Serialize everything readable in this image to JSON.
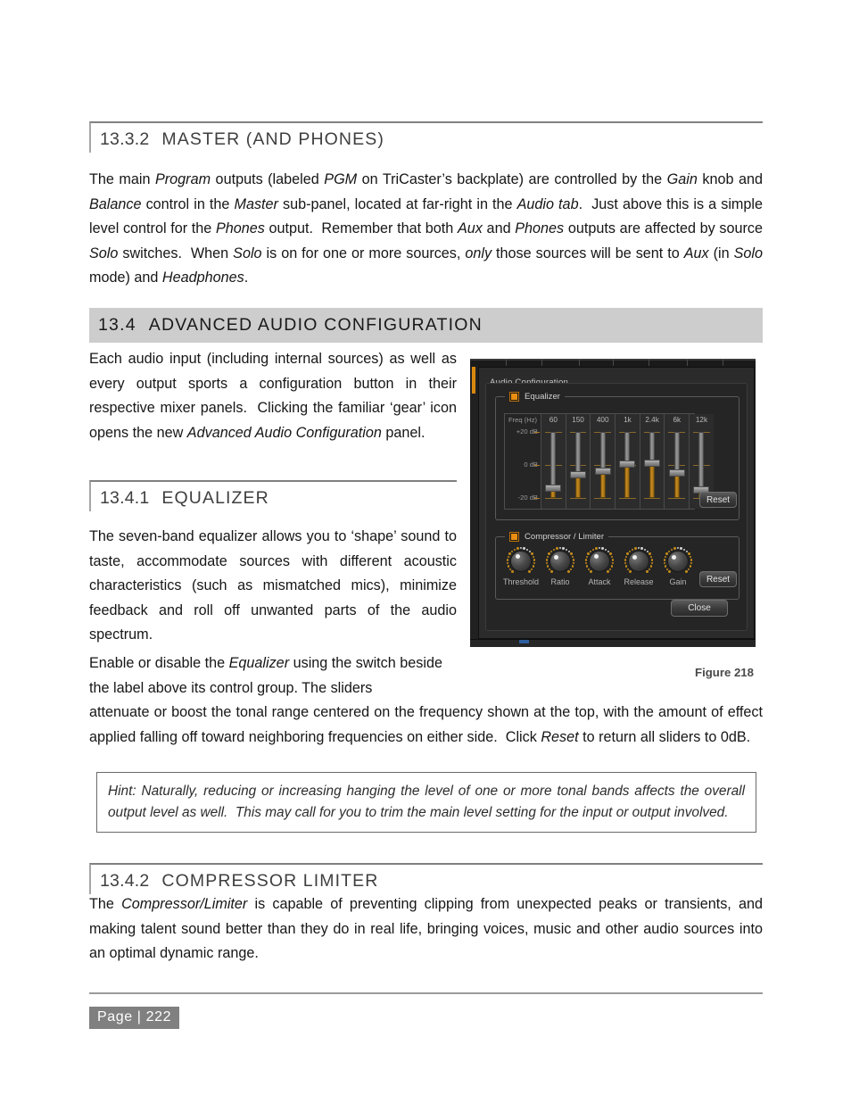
{
  "document": {
    "section_13_3_2": {
      "number": "13.3.2",
      "title": "MASTER (AND PHONES)",
      "body_html": "The main <i>Program</i> outputs (labeled <i>PGM</i> on TriCaster&rsquo;s backplate) are controlled by the <i>Gain</i> knob and <i>Balance</i> control in the <i>Master</i> sub-panel, located at far-right in the <i>Audio tab</i>.&nbsp; Just above this is a simple level control for the <i>Phones</i> output.&nbsp; Remember that both <i>Aux</i> and <i>Phones</i> outputs are affected by source <i>Solo</i> switches.&nbsp; When <i>Solo</i> is on for one or more sources, <i>only</i> those sources will be sent to <i>Aux</i> (in <i>Solo</i> mode) and <i>Headphones</i>."
    },
    "section_13_4": {
      "number": "13.4",
      "title": "ADVANCED AUDIO CONFIGURATION",
      "body_html": "Each audio input (including internal sources) as well as every output sports a configuration button in their respective mixer panels.&nbsp; Clicking the familiar &lsquo;gear&rsquo; icon opens the new <i>Advanced Audio Configuration</i> panel."
    },
    "section_13_4_1": {
      "number": "13.4.1",
      "title": "EQUALIZER",
      "body_html": "The seven-band equalizer allows you to &lsquo;shape&rsquo; sound to taste, accommodate sources with different acoustic characteristics (such as mismatched mics), minimize feedback and roll off unwanted parts of the audio spectrum.",
      "body2_wrapped_html": "Enable or disable the <i>Equalizer</i> using the switch beside the label above its control group. The sliders",
      "body2_full_html": "attenuate or boost the tonal range centered on the frequency shown at the top, with the amount of effect applied falling off toward neighboring frequencies on either side.&nbsp; Click <i>Reset</i> to return all sliders to 0dB."
    },
    "hint_html": "<i>Hint: Naturally, reducing or increasing hanging the level of one or more tonal bands affects the overall output level as well.&nbsp; This may call for you to trim the main level setting for the input or output involved.</i>",
    "section_13_4_2": {
      "number": "13.4.2",
      "title": "COMPRESSOR LIMITER",
      "body_html": "The <i>Compressor/Limiter</i> is capable of preventing clipping from unexpected peaks or transients, and making talent sound better than they do in real life, bringing voices, music and other audio sources into an optimal dynamic range."
    },
    "figure": {
      "caption": "Figure 218"
    },
    "footer": {
      "page_label": "Page  |  222"
    }
  },
  "screenshot": {
    "window_title": "Audio Configuration",
    "equalizer": {
      "group_label": "Equalizer",
      "enabled": true,
      "freq_label": "Freq (Hz)",
      "axis_labels": [
        "+20 dB",
        "0 dB",
        "-20 dB"
      ],
      "bands": [
        "60",
        "150",
        "400",
        "1k",
        "2.4k",
        "6k",
        "12k"
      ],
      "band_values_db": [
        -14,
        -6,
        -4,
        0.5,
        1,
        -5,
        -15
      ],
      "reset_label": "Reset"
    },
    "compressor": {
      "group_label": "Compressor / Limiter",
      "enabled": true,
      "knobs": [
        "Threshold",
        "Ratio",
        "Attack",
        "Release",
        "Gain"
      ],
      "knob_angles_deg": [
        -28,
        -42,
        -36,
        -40,
        -40
      ],
      "reset_label": "Reset"
    },
    "close_label": "Close",
    "colors": {
      "accent_orange": "#e98e10",
      "panel_bg": "#2b2b2b",
      "inner_bg": "#252525",
      "slider_fill": "#c98c1d",
      "text": "#d2d2d2"
    }
  }
}
